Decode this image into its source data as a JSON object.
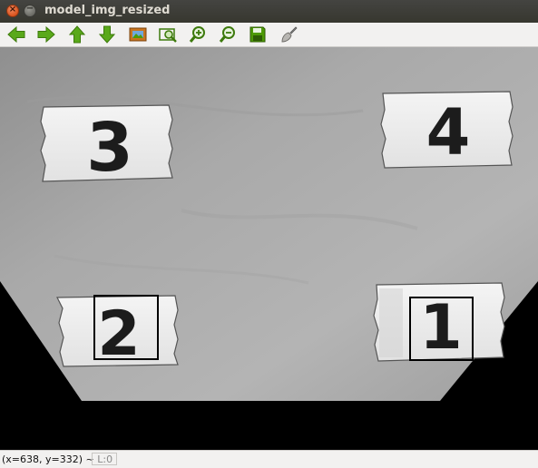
{
  "window": {
    "title": "model_img_resized",
    "close_glyph": "×",
    "minimize_glyph": "−"
  },
  "toolbar": {
    "buttons": [
      {
        "name": "pan-left-button",
        "icon": "arrow-left-icon"
      },
      {
        "name": "pan-right-button",
        "icon": "arrow-right-icon"
      },
      {
        "name": "pan-up-button",
        "icon": "arrow-up-icon"
      },
      {
        "name": "pan-down-button",
        "icon": "arrow-down-icon"
      },
      {
        "name": "zoom-fit-button",
        "icon": "image-icon"
      },
      {
        "name": "zoom-region-button",
        "icon": "zoom-rect-icon"
      },
      {
        "name": "zoom-in-button",
        "icon": "zoom-in-icon"
      },
      {
        "name": "zoom-out-button",
        "icon": "zoom-out-icon"
      },
      {
        "name": "save-button",
        "icon": "floppy-disk-icon"
      },
      {
        "name": "properties-button",
        "icon": "brush-icon"
      }
    ],
    "icon_color": "#4e9a06"
  },
  "image": {
    "cards": [
      {
        "digit": "3"
      },
      {
        "digit": "4"
      },
      {
        "digit": "2"
      },
      {
        "digit": "1"
      }
    ],
    "box_color": "#000000"
  },
  "status": {
    "coords": "(x=638, y=332)",
    "separator": " ~ ",
    "level": "L:0"
  }
}
